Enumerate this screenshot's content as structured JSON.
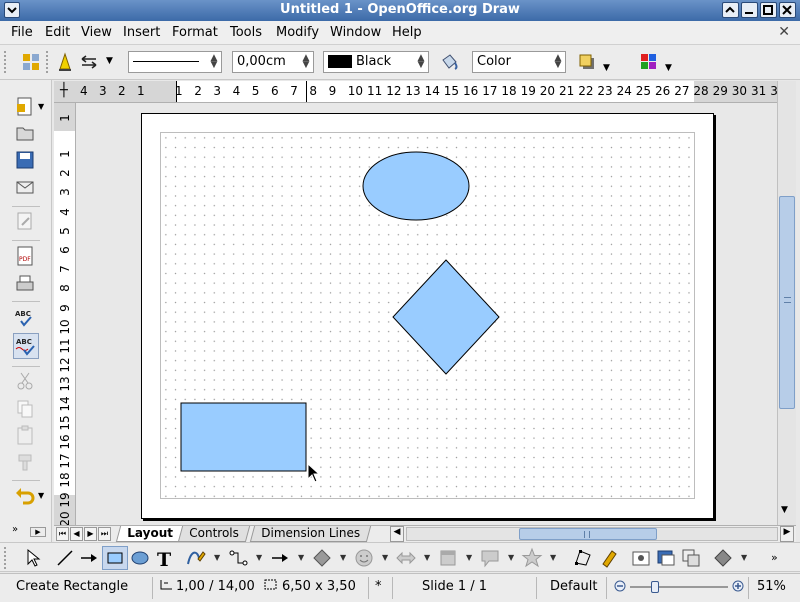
{
  "window": {
    "title": "Untitled 1 - OpenOffice.org Draw"
  },
  "menu": {
    "items": [
      "File",
      "Edit",
      "View",
      "Insert",
      "Format",
      "Tools",
      "Modify",
      "Window",
      "Help"
    ]
  },
  "line_format": {
    "line_width": "0,00cm",
    "line_color": "Black",
    "area_style": "Color"
  },
  "ruler": {
    "horizontal_left": [
      "4",
      "3",
      "2",
      "1"
    ],
    "horizontal_right": [
      "1",
      "2",
      "3",
      "4",
      "5",
      "6",
      "7",
      "8",
      "9",
      "10",
      "11",
      "12",
      "13",
      "14",
      "15",
      "16",
      "17",
      "18",
      "19",
      "20",
      "21",
      "22",
      "23",
      "24",
      "25",
      "26",
      "27",
      "28",
      "29",
      "30",
      "31",
      "3"
    ],
    "vertical": [
      "1",
      "1",
      "2",
      "3",
      "4",
      "5",
      "6",
      "7",
      "8",
      "9",
      "10",
      "11",
      "12",
      "13",
      "14",
      "15",
      "16",
      "17",
      "18",
      "19",
      "20"
    ]
  },
  "tabs": {
    "items": [
      "Layout",
      "Controls",
      "Dimension Lines"
    ],
    "active": "Layout"
  },
  "shapes": {
    "fill_color": "#99ccff",
    "stroke_color": "#000000"
  },
  "status": {
    "action": "Create Rectangle",
    "position": "1,00 / 14,00",
    "size": "6,50 x 3,50",
    "modified": "*",
    "slide": "Slide 1 / 1",
    "layout": "Default",
    "zoom": "51%"
  },
  "colors": {
    "title_bar": "#4a78b4",
    "accent_scroll": "#b7cde8"
  }
}
